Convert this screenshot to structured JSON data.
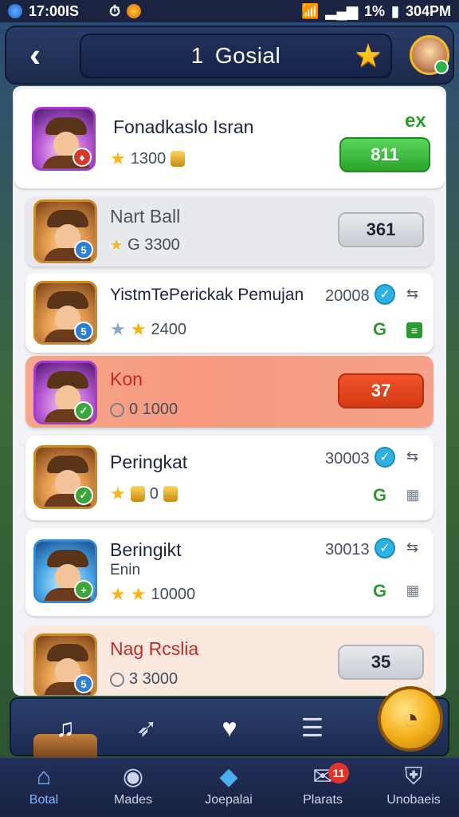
{
  "status_bar": {
    "time_left": "17:00IS",
    "battery": "1%",
    "time_right": "304PM"
  },
  "header": {
    "level": "1",
    "title": "Gosial"
  },
  "rows": [
    {
      "name": "Fonadkaslo Isran",
      "stat": "1300",
      "badge": "ex",
      "button": "811"
    },
    {
      "name": "Nart Ball",
      "stat": "G 3300",
      "button": "361"
    },
    {
      "name": "YistmTePerickak Pemujan",
      "stat": "2400",
      "right_num": "20008"
    },
    {
      "name": "Kon",
      "stat": "0 1000",
      "button": "37"
    },
    {
      "name": "Peringkat",
      "stat": "0",
      "right_num": "30003"
    },
    {
      "name": "Beringikt",
      "sub": "Enin",
      "stat": "10000",
      "right_num": "30013"
    },
    {
      "name": "Nag Rcslia",
      "stat": "3 3000",
      "button": "35"
    }
  ],
  "bottom_nav": [
    {
      "label": "Botal",
      "icon": "home-icon"
    },
    {
      "label": "Mades",
      "icon": "profile-icon"
    },
    {
      "label": "Joepalai",
      "icon": "cube-icon"
    },
    {
      "label": "Plarats",
      "icon": "chat-icon",
      "badge": "11"
    },
    {
      "label": "Unobaeis",
      "icon": "shield-icon"
    }
  ],
  "colors": {
    "accent_green": "#2aa62c",
    "accent_red": "#d43a14",
    "header_navy": "#1c2a4c"
  }
}
